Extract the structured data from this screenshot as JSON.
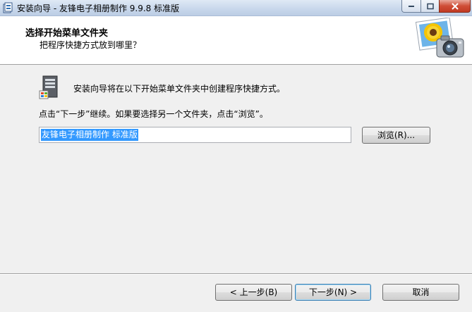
{
  "window": {
    "title": "安装向导 - 友锋电子相册制作 9.9.8 标准版",
    "icon": "installer-icon",
    "controls": {
      "minimize": "minimize-icon",
      "maximize": "maximize-icon",
      "close": "close-icon"
    }
  },
  "header": {
    "title": "选择开始菜单文件夹",
    "subtitle": "把程序快捷方式放到哪里？",
    "image": "sunflower-camera-image"
  },
  "body": {
    "icon": "start-menu-folder-icon",
    "intro": "安装向导将在以下开始菜单文件夹中创建程序快捷方式。",
    "instruction": "点击“下一步”继续。如果要选择另一个文件夹，点击“浏览”。",
    "folder_value": "友锋电子相册制作 标准版",
    "browse_label": "浏览(R)..."
  },
  "footer": {
    "back_label": "< 上一步(B)",
    "next_label": "下一步(N) >",
    "cancel_label": "取消"
  },
  "colors": {
    "selection": "#3399ff",
    "header_background": "#ffffff",
    "dialog_background": "#f0f0f0"
  }
}
